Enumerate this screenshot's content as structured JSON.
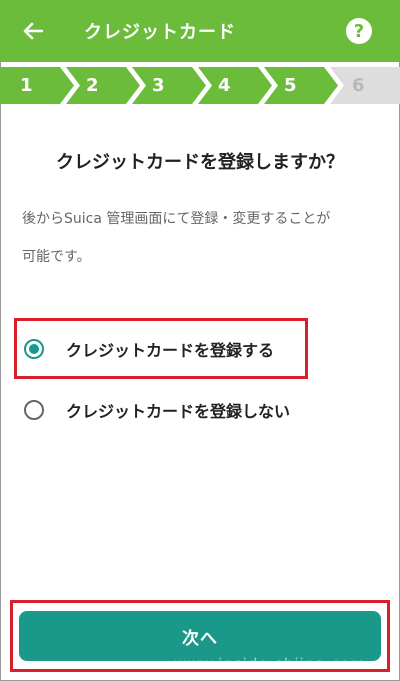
{
  "header": {
    "title": "クレジットカード",
    "back_icon": "arrow-left-icon",
    "help_icon": "question-mark-icon",
    "help_label": "?"
  },
  "steps": [
    {
      "label": "1",
      "state": "done"
    },
    {
      "label": "2",
      "state": "done"
    },
    {
      "label": "3",
      "state": "done"
    },
    {
      "label": "4",
      "state": "done"
    },
    {
      "label": "5",
      "state": "done"
    },
    {
      "label": "6",
      "state": "todo"
    }
  ],
  "main": {
    "question": "クレジットカードを登録しますか？",
    "description_line1": "後からSuica 管理画面にて登録・変更することが",
    "description_line2": "可能です。",
    "options": [
      {
        "label": "クレジットカードを登録する",
        "selected": true
      },
      {
        "label": "クレジットカードを登録しない",
        "selected": false
      }
    ]
  },
  "footer": {
    "next_label": "次へ"
  },
  "watermark": "www.inside-shiina.com",
  "colors": {
    "header_green": "#6cbc3c",
    "accent_teal": "#1a9889",
    "highlight_red": "#d91f2a"
  }
}
